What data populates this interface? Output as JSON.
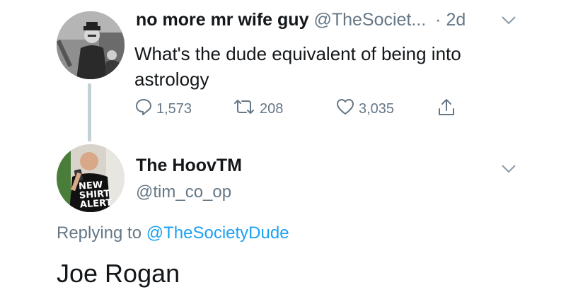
{
  "tweet": {
    "author_name": "no more mr wife guy",
    "author_handle": "@TheSociet...",
    "time": "· 2d",
    "text": "What's the dude equivalent of being into astrology",
    "stats": {
      "replies": "1,573",
      "retweets": "208",
      "likes": "3,035"
    }
  },
  "reply": {
    "author_name": "The HoovTM",
    "author_handle": "@tim_co_op",
    "replying_label": "Replying to",
    "replying_to": "@TheSocietyDude",
    "text": "Joe Rogan",
    "avatar_shirt_text": [
      "NEW",
      "SHIRT",
      "ALERT"
    ]
  },
  "icons": [
    "chevron-down-icon",
    "reply-icon",
    "retweet-icon",
    "like-icon",
    "share-icon"
  ],
  "colors": {
    "link": "#1da1f2",
    "secondary_text": "#657786",
    "thread_line": "#c4cfd6"
  }
}
